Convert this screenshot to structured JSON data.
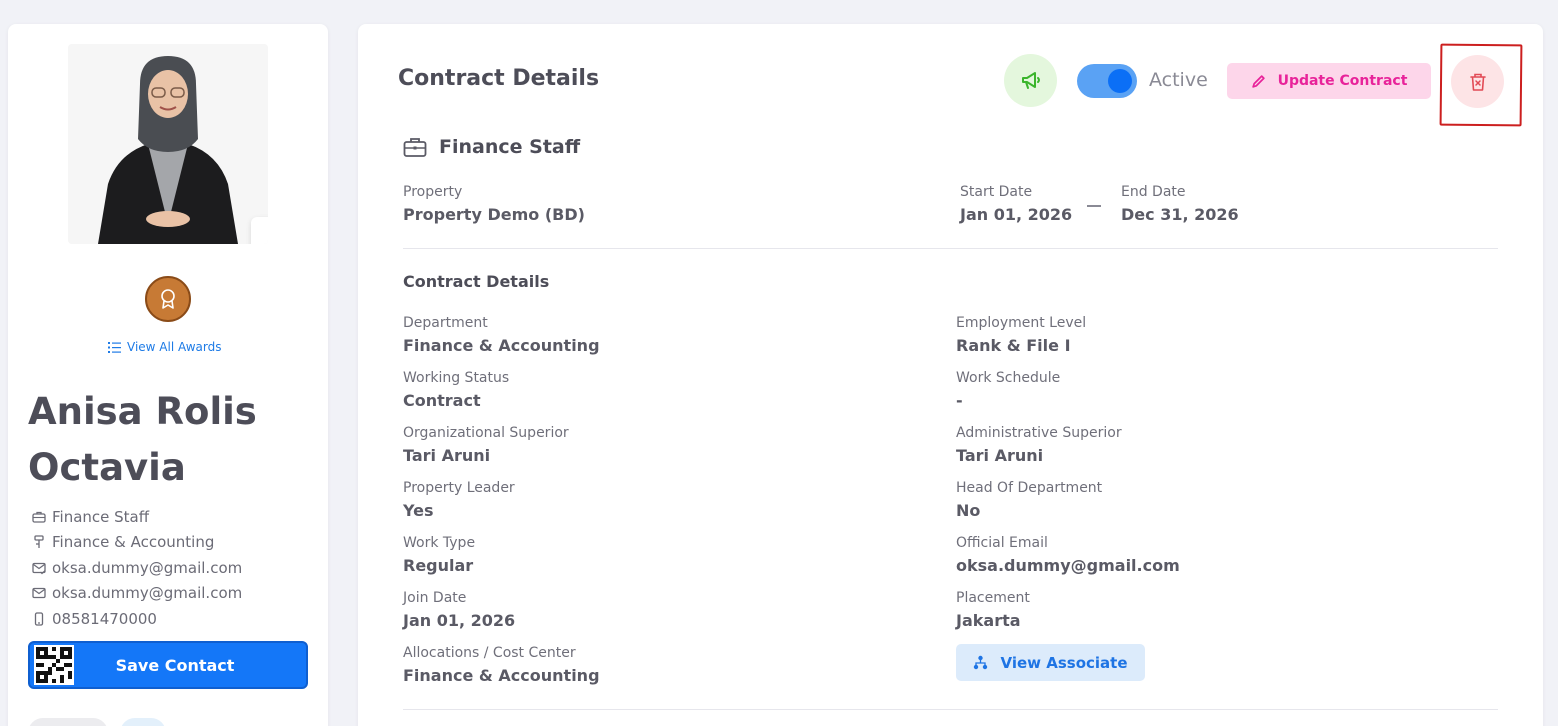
{
  "profile": {
    "name": "Anisa Rolis Octavia",
    "edit_photo_icon": "pencil-icon",
    "award_icon": "medal-icon",
    "view_awards_label": "View All Awards",
    "info": [
      {
        "icon": "briefcase-icon",
        "text": "Finance Staff"
      },
      {
        "icon": "department-icon",
        "text": "Finance & Accounting"
      },
      {
        "icon": "mail-check-icon",
        "text": "oksa.dummy@gmail.com"
      },
      {
        "icon": "mail-icon",
        "text": "oksa.dummy@gmail.com"
      },
      {
        "icon": "phone-icon",
        "text": "08581470000"
      }
    ],
    "save_contact_label": "Save Contact"
  },
  "contract": {
    "title": "Contract Details",
    "status_label": "Active",
    "status_active": true,
    "update_label": "Update Contract",
    "position": "Finance Staff",
    "property_label": "Property",
    "property_value": "Property Demo (BD)",
    "start_label": "Start Date",
    "start_value": "Jan 01, 2026",
    "end_label": "End Date",
    "end_value": "Dec 31, 2026",
    "section_title": "Contract Details",
    "fields_left": [
      {
        "label": "Department",
        "value": "Finance & Accounting"
      },
      {
        "label": "Working Status",
        "value": "Contract"
      },
      {
        "label": "Organizational Superior",
        "value": "Tari Aruni"
      },
      {
        "label": "Property Leader",
        "value": "Yes"
      },
      {
        "label": "Work Type",
        "value": "Regular"
      },
      {
        "label": "Join Date",
        "value": "Jan 01, 2026"
      },
      {
        "label": "Allocations / Cost Center",
        "value": "Finance & Accounting"
      }
    ],
    "fields_right": [
      {
        "label": "Employment Level",
        "value": "Rank & File I"
      },
      {
        "label": "Work Schedule",
        "value": "-"
      },
      {
        "label": "Administrative Superior",
        "value": "Tari Aruni"
      },
      {
        "label": "Head Of Department",
        "value": "No"
      },
      {
        "label": "Official Email",
        "value": "oksa.dummy@gmail.com"
      },
      {
        "label": "Placement",
        "value": "Jakarta"
      }
    ],
    "view_associate_label": "View Associate"
  },
  "colors": {
    "primary": "#1477f8",
    "update_pink": "#e8239a",
    "delete_red": "#e24a55",
    "announce_green": "#3bb52c",
    "annotation_red": "#cc1f1f"
  }
}
